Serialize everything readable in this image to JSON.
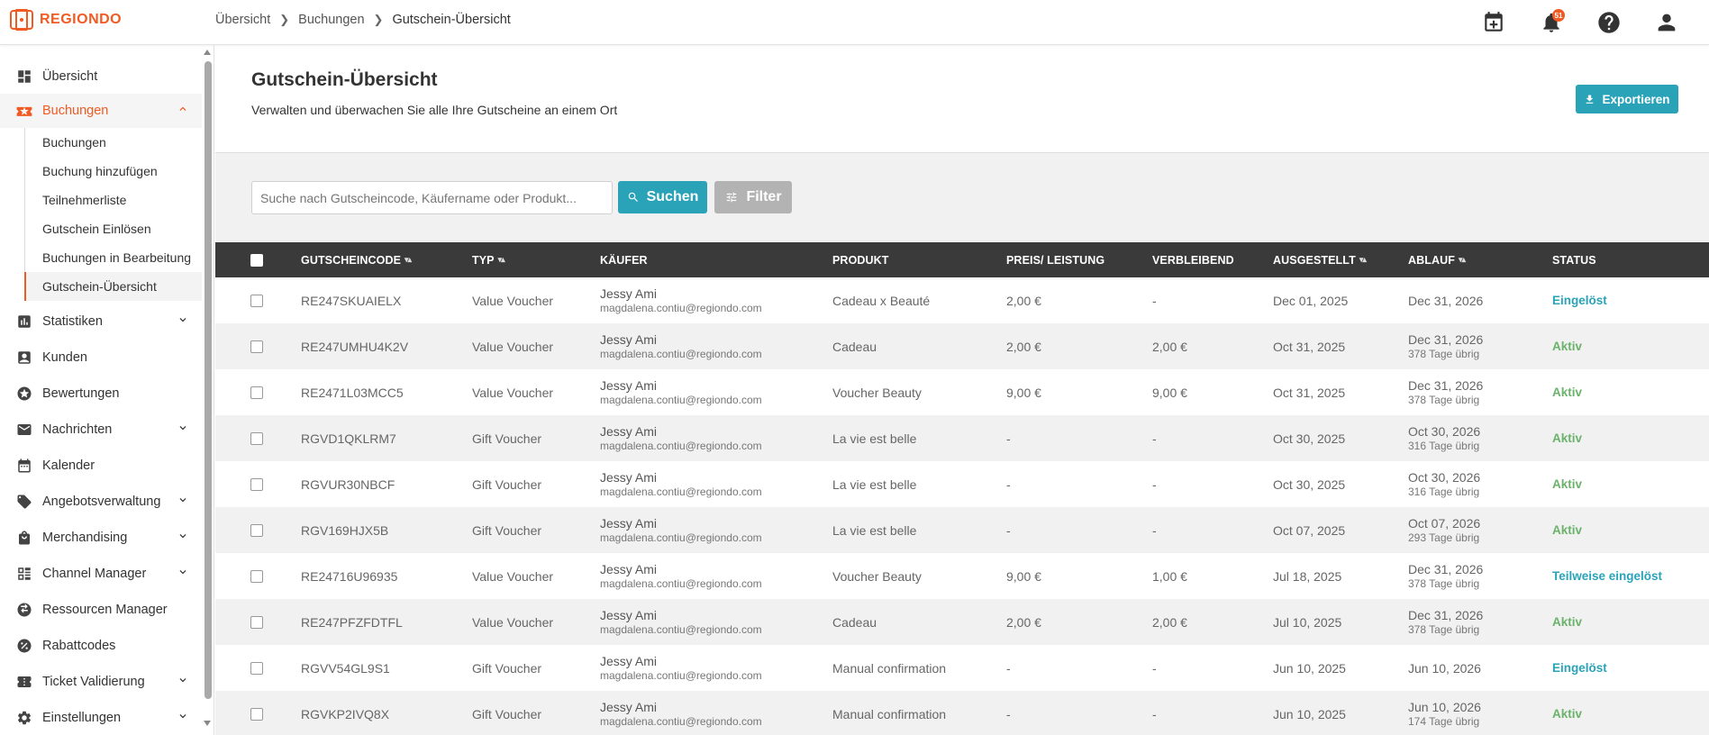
{
  "app": {
    "logo_text": "REGIONDO"
  },
  "breadcrumb": [
    "Übersicht",
    "Buchungen",
    "Gutschein-Übersicht"
  ],
  "topbar": {
    "notification_count": "51"
  },
  "sidebar": {
    "items": [
      {
        "label": "Übersicht",
        "icon": "dashboard-icon",
        "expandable": false
      },
      {
        "label": "Buchungen",
        "icon": "ticket-star-icon",
        "expandable": true,
        "expanded": true
      },
      {
        "label": "Statistiken",
        "icon": "bar-chart-icon",
        "expandable": true
      },
      {
        "label": "Kunden",
        "icon": "person-card-icon",
        "expandable": false
      },
      {
        "label": "Bewertungen",
        "icon": "star-circle-icon",
        "expandable": false
      },
      {
        "label": "Nachrichten",
        "icon": "mail-icon",
        "expandable": true
      },
      {
        "label": "Kalender",
        "icon": "calendar-icon",
        "expandable": false
      },
      {
        "label": "Angebotsverwaltung",
        "icon": "tag-icon",
        "expandable": true
      },
      {
        "label": "Merchandising",
        "icon": "shopping-bag-icon",
        "expandable": true
      },
      {
        "label": "Channel Manager",
        "icon": "channel-icon",
        "expandable": true
      },
      {
        "label": "Ressourcen Manager",
        "icon": "swap-icon",
        "expandable": false
      },
      {
        "label": "Rabattcodes",
        "icon": "percent-icon",
        "expandable": false
      },
      {
        "label": "Ticket Validierung",
        "icon": "ticket-icon",
        "expandable": true
      },
      {
        "label": "Einstellungen",
        "icon": "gear-icon",
        "expandable": true
      }
    ],
    "sub_items": [
      "Buchungen",
      "Buchung hinzufügen",
      "Teilnehmerliste",
      "Gutschein Einlösen",
      "Buchungen in Bearbeitung",
      "Gutschein-Übersicht"
    ]
  },
  "header": {
    "title": "Gutschein-Übersicht",
    "subtitle": "Verwalten und überwachen Sie alle Ihre Gutscheine an einem Ort",
    "export_label": "Exportieren"
  },
  "search": {
    "placeholder": "Suche nach Gutscheincode, Käufername oder Produkt...",
    "button_label": "Suchen",
    "filter_label": "Filter"
  },
  "table": {
    "columns": [
      "GUTSCHEINCODE",
      "TYP",
      "KÄUFER",
      "PRODUKT",
      "PREIS/ LEISTUNG",
      "VERBLEIBEND",
      "AUSGESTELLT",
      "ABLAUF",
      "STATUS"
    ],
    "rows": [
      {
        "code": "RE247SKUAIELX",
        "type": "Value Voucher",
        "buyer": "Jessy Ami",
        "email": "magdalena.contiu@regiondo.com",
        "product": "Cadeau x Beauté",
        "price": "2,00 €",
        "remaining": "-",
        "issued": "Dec 01, 2025",
        "expiry": "Dec 31, 2026",
        "expiry_note": "",
        "status": "Eingelöst",
        "status_kind": "redeemed"
      },
      {
        "code": "RE247UMHU4K2V",
        "type": "Value Voucher",
        "buyer": "Jessy Ami",
        "email": "magdalena.contiu@regiondo.com",
        "product": "Cadeau",
        "price": "2,00 €",
        "remaining": "2,00 €",
        "issued": "Oct 31, 2025",
        "expiry": "Dec 31, 2026",
        "expiry_note": "378 Tage übrig",
        "status": "Aktiv",
        "status_kind": "active"
      },
      {
        "code": "RE2471L03MCC5",
        "type": "Value Voucher",
        "buyer": "Jessy Ami",
        "email": "magdalena.contiu@regiondo.com",
        "product": "Voucher Beauty",
        "price": "9,00 €",
        "remaining": "9,00 €",
        "issued": "Oct 31, 2025",
        "expiry": "Dec 31, 2026",
        "expiry_note": "378 Tage übrig",
        "status": "Aktiv",
        "status_kind": "active"
      },
      {
        "code": "RGVD1QKLRM7",
        "type": "Gift Voucher",
        "buyer": "Jessy Ami",
        "email": "magdalena.contiu@regiondo.com",
        "product": "La vie est belle",
        "price": "-",
        "remaining": "-",
        "issued": "Oct 30, 2025",
        "expiry": "Oct 30, 2026",
        "expiry_note": "316 Tage übrig",
        "status": "Aktiv",
        "status_kind": "active"
      },
      {
        "code": "RGVUR30NBCF",
        "type": "Gift Voucher",
        "buyer": "Jessy Ami",
        "email": "magdalena.contiu@regiondo.com",
        "product": "La vie est belle",
        "price": "-",
        "remaining": "-",
        "issued": "Oct 30, 2025",
        "expiry": "Oct 30, 2026",
        "expiry_note": "316 Tage übrig",
        "status": "Aktiv",
        "status_kind": "active"
      },
      {
        "code": "RGV169HJX5B",
        "type": "Gift Voucher",
        "buyer": "Jessy Ami",
        "email": "magdalena.contiu@regiondo.com",
        "product": "La vie est belle",
        "price": "-",
        "remaining": "-",
        "issued": "Oct 07, 2025",
        "expiry": "Oct 07, 2026",
        "expiry_note": "293 Tage übrig",
        "status": "Aktiv",
        "status_kind": "active"
      },
      {
        "code": "RE24716U96935",
        "type": "Value Voucher",
        "buyer": "Jessy Ami",
        "email": "magdalena.contiu@regiondo.com",
        "product": "Voucher Beauty",
        "price": "9,00 €",
        "remaining": "1,00 €",
        "issued": "Jul 18, 2025",
        "expiry": "Dec 31, 2026",
        "expiry_note": "378 Tage übrig",
        "status": "Teilweise eingelöst",
        "status_kind": "redeemed"
      },
      {
        "code": "RE247PFZFDTFL",
        "type": "Value Voucher",
        "buyer": "Jessy Ami",
        "email": "magdalena.contiu@regiondo.com",
        "product": "Cadeau",
        "price": "2,00 €",
        "remaining": "2,00 €",
        "issued": "Jul 10, 2025",
        "expiry": "Dec 31, 2026",
        "expiry_note": "378 Tage übrig",
        "status": "Aktiv",
        "status_kind": "active"
      },
      {
        "code": "RGVV54GL9S1",
        "type": "Gift Voucher",
        "buyer": "Jessy Ami",
        "email": "magdalena.contiu@regiondo.com",
        "product": "Manual confirmation",
        "price": "-",
        "remaining": "-",
        "issued": "Jun 10, 2025",
        "expiry": "Jun 10, 2026",
        "expiry_note": "",
        "status": "Eingelöst",
        "status_kind": "redeemed"
      },
      {
        "code": "RGVKP2IVQ8X",
        "type": "Gift Voucher",
        "buyer": "Jessy Ami",
        "email": "magdalena.contiu@regiondo.com",
        "product": "Manual confirmation",
        "price": "-",
        "remaining": "-",
        "issued": "Jun 10, 2025",
        "expiry": "Jun 10, 2026",
        "expiry_note": "174 Tage übrig",
        "status": "Aktiv",
        "status_kind": "active"
      }
    ]
  },
  "colors": {
    "brand": "#f15a22",
    "accent": "#2aa3b9",
    "active_status": "#6bb26b",
    "header_bg": "#3a3a3a"
  }
}
